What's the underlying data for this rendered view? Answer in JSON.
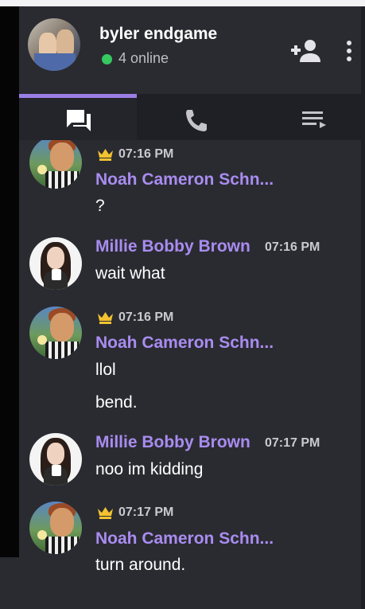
{
  "header": {
    "group_name": "byler endgame",
    "online_text": "4 online",
    "online_color": "#35c95f",
    "actions": [
      "add-user-icon",
      "more-icon"
    ]
  },
  "tabs": [
    {
      "icon": "chat-icon",
      "active": true
    },
    {
      "icon": "phone-icon",
      "active": false
    },
    {
      "icon": "playlist-icon",
      "active": false
    }
  ],
  "accent_color": "#9b7fe6",
  "messages": [
    {
      "author": "Noah Cameron Schn...",
      "time": "07:16 PM",
      "owner_badge": "crown-icon",
      "lines": [
        "?"
      ]
    },
    {
      "author": "Millie Bobby Brown",
      "time": "07:16 PM",
      "lines": [
        "wait what"
      ]
    },
    {
      "author": "Noah Cameron Schn...",
      "time": "07:16 PM",
      "owner_badge": "crown-icon",
      "lines": [
        "llol",
        "bend."
      ]
    },
    {
      "author": "Millie Bobby Brown",
      "time": "07:17 PM",
      "lines": [
        "noo im kidding"
      ]
    },
    {
      "author": "Noah Cameron Schn...",
      "time": "07:17 PM",
      "owner_badge": "crown-icon",
      "lines": [
        "turn around."
      ]
    }
  ]
}
